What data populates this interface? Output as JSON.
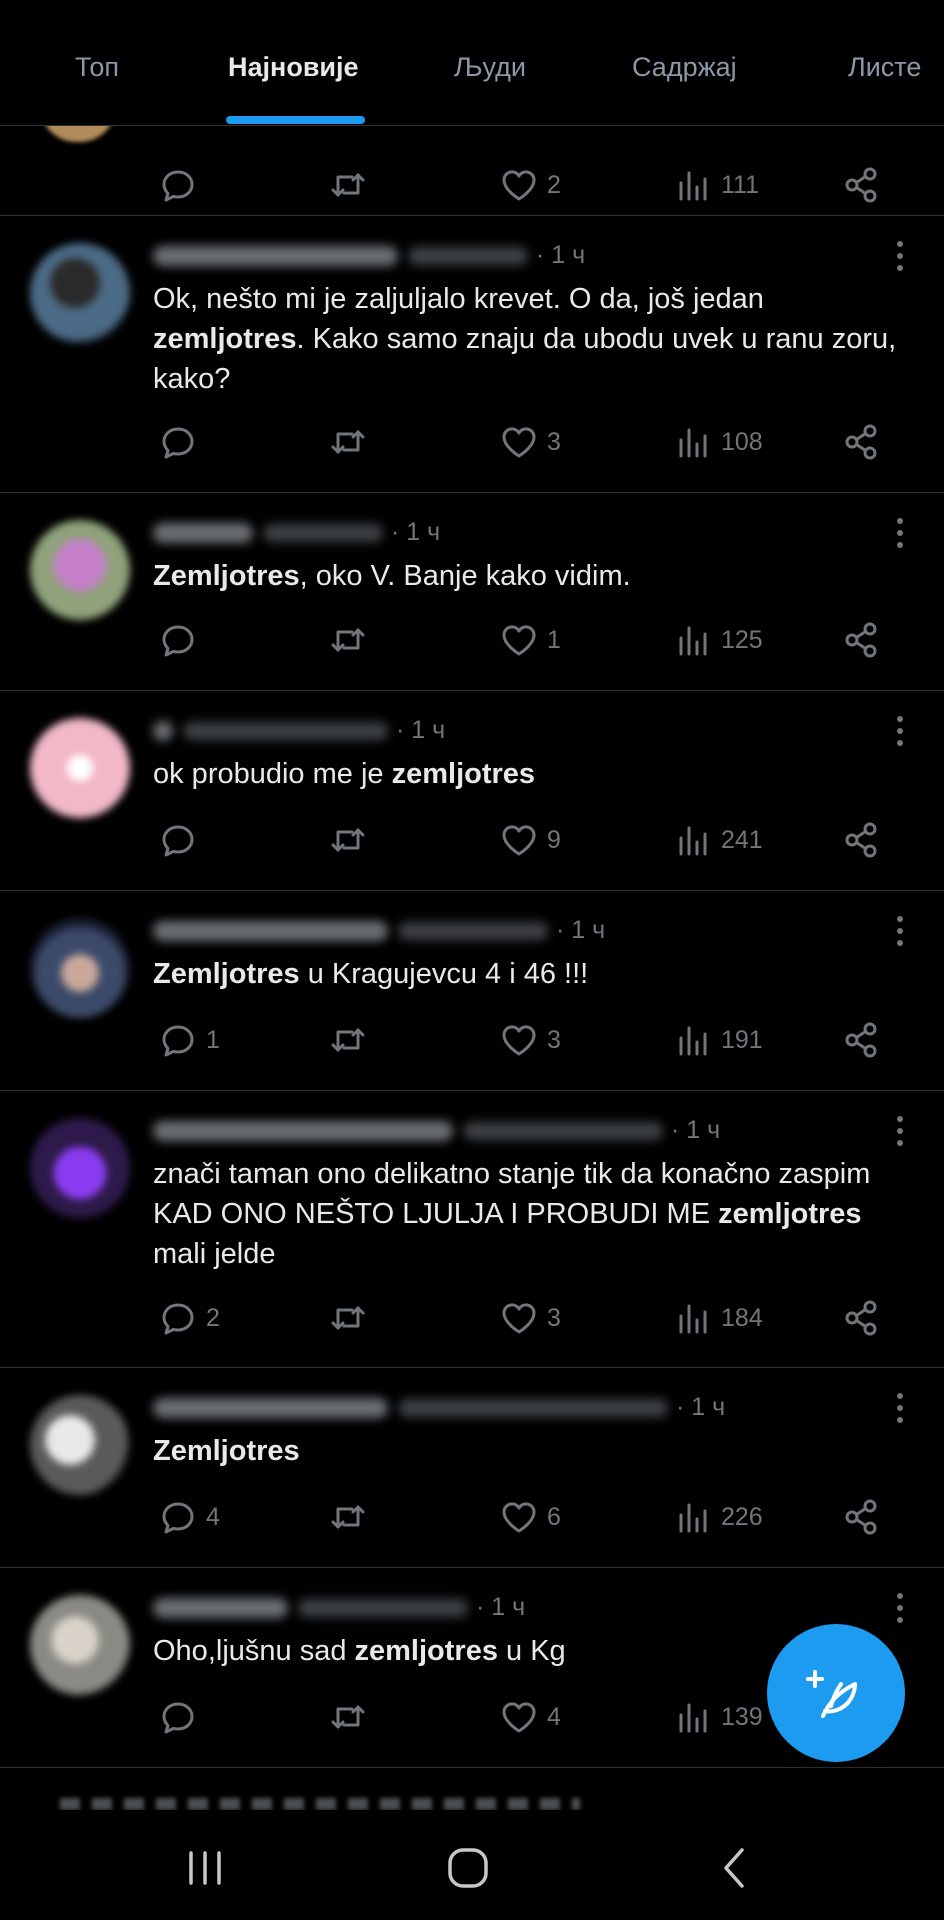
{
  "tabs": [
    {
      "label": "Топ"
    },
    {
      "label": "Најновије"
    },
    {
      "label": "Људи"
    },
    {
      "label": "Садржај"
    },
    {
      "label": "Листе"
    }
  ],
  "partial_tweet": {
    "likes": "2",
    "views": "111"
  },
  "tweets": [
    {
      "time": "· 1 ч",
      "text_parts": [
        "Ok, nešto mi je zaljuljalo krevet. O da, još jedan ",
        "zemljotres",
        ". Kako samo znaju da ubodu uvek u ranu zoru, kako?"
      ],
      "replies": "",
      "likes": "3",
      "views": "108"
    },
    {
      "time": "· 1 ч",
      "text_parts": [
        "",
        "Zemljotres",
        ", oko V. Banje kako vidim."
      ],
      "replies": "",
      "likes": "1",
      "views": "125"
    },
    {
      "time": "· 1 ч",
      "text_parts": [
        "ok probudio me je ",
        "zemljotres",
        ""
      ],
      "replies": "",
      "likes": "9",
      "views": "241"
    },
    {
      "time": "· 1 ч",
      "text_parts": [
        "",
        "Zemljotres",
        " u Kragujevcu 4 i 46 !!!"
      ],
      "replies": "1",
      "likes": "3",
      "views": "191"
    },
    {
      "time": "· 1 ч",
      "text_parts": [
        "znači taman ono delikatno stanje tik da konačno zaspim KAD ONO NEŠTO LJULJA I PROBUDI ME ",
        "zemljotres",
        " mali jelde"
      ],
      "replies": "2",
      "likes": "3",
      "views": "184"
    },
    {
      "time": "· 1 ч",
      "text_parts": [
        "",
        "Zemljotres",
        ""
      ],
      "replies": "4",
      "likes": "6",
      "views": "226"
    },
    {
      "time": "· 1 ч",
      "text_parts": [
        "Oho,ljušnu sad ",
        "zemljotres",
        " u Kg"
      ],
      "replies": "",
      "likes": "4",
      "views": "139"
    }
  ],
  "colors": {
    "accent": "#1d9bf0",
    "background": "#000000",
    "muted": "#71767b",
    "text": "#e7e9ea"
  }
}
